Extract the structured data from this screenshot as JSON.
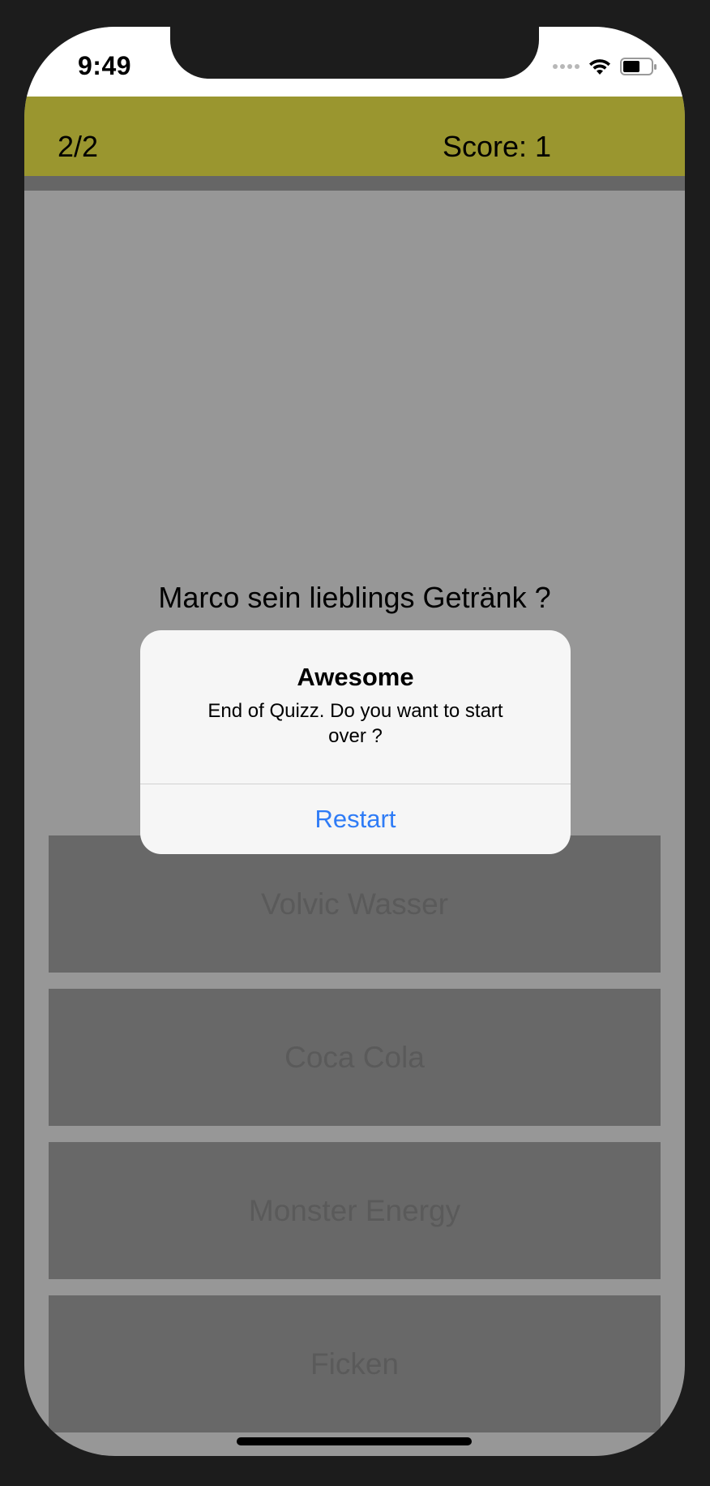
{
  "status_bar": {
    "time": "9:49"
  },
  "header": {
    "counter": "2/2",
    "score": "Score: 1",
    "accent_color": "#9a962f",
    "progress": 1.0
  },
  "question": {
    "text": "Marco sein lieblings Getränk ?"
  },
  "answers": [
    {
      "label": "Volvic Wasser"
    },
    {
      "label": "Coca Cola"
    },
    {
      "label": "Monster Energy"
    },
    {
      "label": "Ficken"
    }
  ],
  "alert": {
    "title": "Awesome",
    "message": "End of Quizz. Do you want to start over ?",
    "button_label": "Restart",
    "button_color": "#2f7cf6"
  },
  "icons": [
    "wifi-icon",
    "battery-icon",
    "cellular-signal-icon"
  ]
}
